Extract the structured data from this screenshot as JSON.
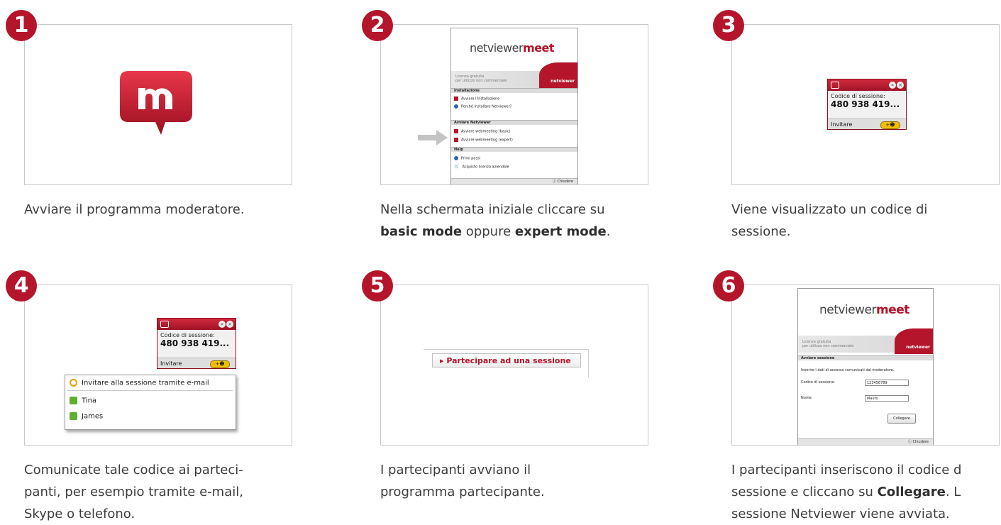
{
  "steps": [
    {
      "number": "1",
      "caption": "Avviare il programma moderatore."
    },
    {
      "number": "2",
      "caption_line1": "Nella schermata iniziale cliccare su",
      "caption_bold1": "basic mode",
      "caption_mid": " oppure ",
      "caption_bold2": "expert mode",
      "caption_end": "."
    },
    {
      "number": "3",
      "caption_line1": "Viene visualizzato un codice di",
      "caption_line2": "sessione."
    },
    {
      "number": "4",
      "caption_line1": "Comunicate tale codice ai parteci-",
      "caption_line2": "panti, per esempio tramite e-mail,",
      "caption_line3": "Skype o telefono."
    },
    {
      "number": "5",
      "caption_line1": "I partecipanti avviano il",
      "caption_line2": "programma partecipante."
    },
    {
      "number": "6",
      "caption_line1": "I partecipanti inseriscono il codice d",
      "caption_line2a": "sessione e cliccano su ",
      "caption_bold": "Collegare",
      "caption_line2b": ". L",
      "caption_line3": "sessione Netviewer viene avviata."
    }
  ],
  "launcher": {
    "brand_main": "netviewer",
    "brand_meet": "meet",
    "license_line1": "Licenza gratuita",
    "license_line2": "per utilizzo non commerciale",
    "tab_brand": "netviewer",
    "section_install": "Installazione",
    "item_install": "Avviare l'installazione",
    "item_why": "Perché installare Netviewer?",
    "section_start": "Avviare Netviewer",
    "item_basic": "Avviare webmeeting (basic)",
    "item_expert": "Avviare webmeeting (expert)",
    "section_help": "Help",
    "item_first": "Primi passi",
    "item_buy": "Acquisto licenza aziendale",
    "close": "Chiudere"
  },
  "widget": {
    "label": "Codice di sessione:",
    "code": "480 938 419...",
    "invite": "Invitare",
    "plus": "+☻"
  },
  "invite_popup": {
    "email": "Invitare alla sessione tramite e-mail",
    "contact1": "Tina",
    "contact2": "James"
  },
  "join": {
    "button": "▸ Partecipare ad una sessione"
  },
  "session_dialog": {
    "brand_main": "netviewer",
    "brand_meet": "meet",
    "license_line1": "Licenza gratuita",
    "license_line2": "per utilizzo non commerciale",
    "tab_brand": "netviewer",
    "section": "Avviare sessione",
    "instruction": "Inserire i dati di accesso comunicati dal moderatore.",
    "code_label": "Codice di sessione:",
    "code_value": "123456789",
    "name_label": "Nome:",
    "name_value": "Mauro",
    "connect": "Collegare",
    "close": "Chiudere"
  },
  "colors": {
    "accent": "#b5152b",
    "frame_border": "#c9c9c9",
    "text": "#3e3e3e"
  }
}
